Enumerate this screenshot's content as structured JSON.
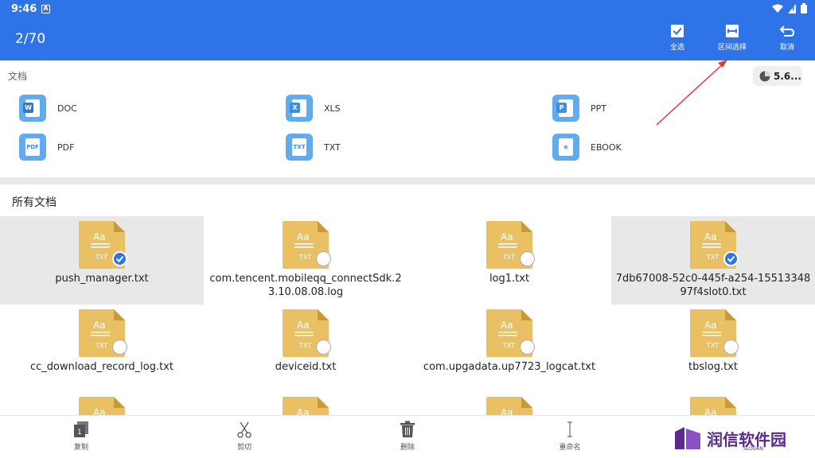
{
  "status": {
    "time": "9:46",
    "a_icon": "A"
  },
  "header": {
    "count": "2/70",
    "actions": [
      {
        "label": "全选",
        "icon": "select-all-icon"
      },
      {
        "label": "区间选择",
        "icon": "range-select-icon"
      },
      {
        "label": "取消",
        "icon": "undo-icon"
      }
    ]
  },
  "docs_section": {
    "title": "文档",
    "storage_label": "5.6...",
    "categories": [
      {
        "label": "DOC",
        "badge": "W",
        "badge_color": "#2b79d6"
      },
      {
        "label": "XLS",
        "badge": "X",
        "badge_color": "#3a8fe0"
      },
      {
        "label": "PPT",
        "badge": "P",
        "badge_color": "#3a8fe0"
      },
      {
        "label": "PDF",
        "badge": "PDF",
        "badge_color": "#63abef"
      },
      {
        "label": "TXT",
        "badge": "TXT",
        "badge_color": "#63abef"
      },
      {
        "label": "EBOOK",
        "badge": "e",
        "badge_color": "#63abef"
      }
    ]
  },
  "all_docs": {
    "title": "所有文档",
    "files": [
      {
        "name": "push_manager.txt",
        "selected": true
      },
      {
        "name": "com.tencent.mobileqq_connectSdk.23.10.08.08.log",
        "selected": false
      },
      {
        "name": "log1.txt",
        "selected": false
      },
      {
        "name": "7db67008-52c0-445f-a254-1551334897f4slot0.txt",
        "selected": true
      },
      {
        "name": "cc_download_record_log.txt",
        "selected": false
      },
      {
        "name": "deviceid.txt",
        "selected": false
      },
      {
        "name": "com.upgadata.up7723_logcat.txt",
        "selected": false
      },
      {
        "name": "tbslog.txt",
        "selected": false
      }
    ],
    "icon_text_top": "Aa",
    "icon_text_bottom": "TXT"
  },
  "bottom_bar": {
    "items": [
      {
        "label": "复制",
        "icon": "copy-icon"
      },
      {
        "label": "剪切",
        "icon": "scissors-icon"
      },
      {
        "label": "删除",
        "icon": "trash-icon"
      },
      {
        "label": "重命名",
        "icon": "rename-icon"
      }
    ]
  },
  "watermark": {
    "brand": "润信软件园",
    "slogan": "SLOGAN"
  },
  "colors": {
    "primary": "#2f73e8",
    "file_icon": "#e9c064",
    "category_icon": "#63abef",
    "annotation": "#e53935"
  }
}
